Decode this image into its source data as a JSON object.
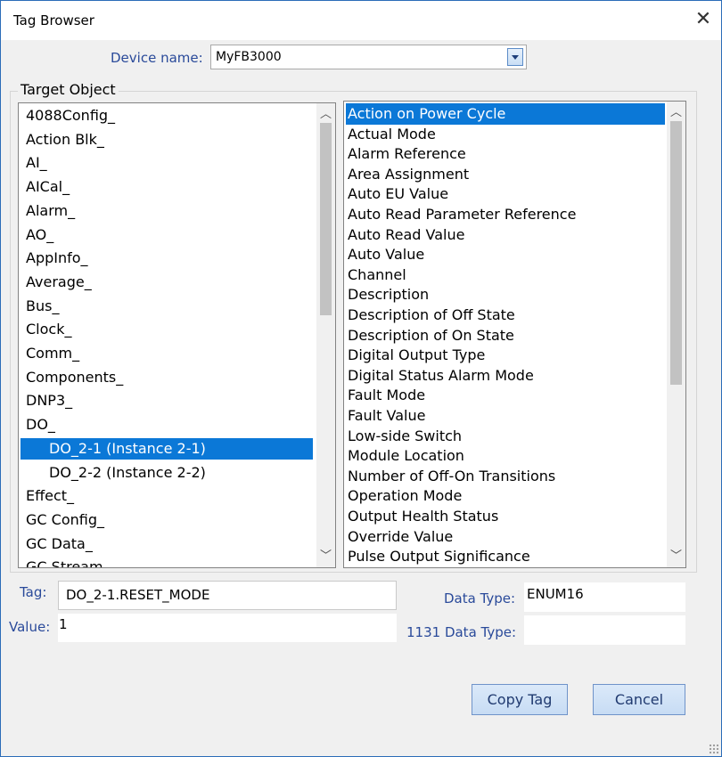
{
  "window": {
    "title": "Tag Browser"
  },
  "device": {
    "label": "Device name:",
    "value": "MyFB3000"
  },
  "group": {
    "label": "Target Object"
  },
  "objects": {
    "items": [
      {
        "label": "4088Config_"
      },
      {
        "label": "Action Blk_"
      },
      {
        "label": "AI_"
      },
      {
        "label": "AICal_"
      },
      {
        "label": "Alarm_"
      },
      {
        "label": "AO_"
      },
      {
        "label": "AppInfo_"
      },
      {
        "label": "Average_"
      },
      {
        "label": "Bus_"
      },
      {
        "label": "Clock_"
      },
      {
        "label": "Comm_"
      },
      {
        "label": "Components_"
      },
      {
        "label": "DNP3_"
      },
      {
        "label": "DO_"
      },
      {
        "label": "DO_2-1 (Instance 2-1)"
      },
      {
        "label": "DO_2-2 (Instance 2-2)"
      },
      {
        "label": "Effect_"
      },
      {
        "label": "GC Config_"
      },
      {
        "label": "GC Data_"
      },
      {
        "label": "GC Stream_"
      }
    ],
    "selected_index": 14,
    "scroll_fraction": 0.0
  },
  "parameters": {
    "items": [
      {
        "label": "Action on Power Cycle"
      },
      {
        "label": "Actual Mode"
      },
      {
        "label": "Alarm Reference"
      },
      {
        "label": "Area Assignment"
      },
      {
        "label": "Auto EU Value"
      },
      {
        "label": "Auto Read Parameter Reference"
      },
      {
        "label": "Auto Read Value"
      },
      {
        "label": "Auto Value"
      },
      {
        "label": "Channel"
      },
      {
        "label": "Description"
      },
      {
        "label": "Description of Off State"
      },
      {
        "label": "Description of On State"
      },
      {
        "label": "Digital Output Type"
      },
      {
        "label": "Digital Status Alarm Mode"
      },
      {
        "label": "Fault Mode"
      },
      {
        "label": "Fault Value"
      },
      {
        "label": "Low-side Switch"
      },
      {
        "label": "Module Location"
      },
      {
        "label": "Number of Off-On Transitions"
      },
      {
        "label": "Operation Mode"
      },
      {
        "label": "Output Health Status"
      },
      {
        "label": "Override Value"
      },
      {
        "label": "Pulse Output Significance"
      }
    ],
    "selected_index": 0
  },
  "fields": {
    "tag_label": "Tag:",
    "tag_value": "DO_2-1.RESET_MODE",
    "value_label": "Value:",
    "value_value": "1",
    "data_type_label": "Data Type:",
    "data_type_value": "ENUM16",
    "iec_type_label": "1131 Data Type:",
    "iec_type_value": ""
  },
  "buttons": {
    "copy": "Copy Tag",
    "cancel": "Cancel"
  },
  "icons": {
    "close": "close-icon",
    "dropdown": "chevron-down-icon",
    "scroll_up": "chevron-up-icon",
    "scroll_down": "chevron-down-icon",
    "grip": "resize-grip-icon"
  },
  "colors": {
    "selection": "#0b78d7",
    "label_blue": "#2a4a9a",
    "button": "#c7dcf4"
  }
}
